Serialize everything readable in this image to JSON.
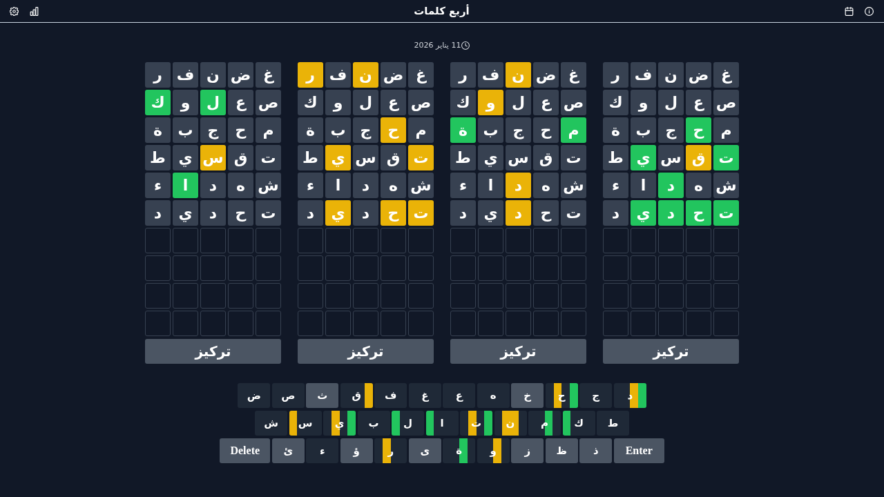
{
  "header": {
    "title": "أربع كلمات",
    "date": "11 يناير 2026"
  },
  "boards": [
    {
      "rows": [
        {
          "tiles": [
            {
              "letter": "غ",
              "kind": "absent"
            },
            {
              "letter": "ض",
              "kind": "absent"
            },
            {
              "letter": "ن",
              "kind": "absent"
            },
            {
              "letter": "ف",
              "kind": "absent"
            },
            {
              "letter": "ر",
              "kind": "absent"
            }
          ]
        },
        {
          "tiles": [
            {
              "letter": "ص",
              "kind": "absent"
            },
            {
              "letter": "ع",
              "kind": "absent"
            },
            {
              "letter": "ل",
              "kind": "absent"
            },
            {
              "letter": "و",
              "kind": "absent"
            },
            {
              "letter": "ك",
              "kind": "absent"
            }
          ]
        },
        {
          "tiles": [
            {
              "letter": "م",
              "kind": "absent"
            },
            {
              "letter": "ح",
              "kind": "correct"
            },
            {
              "letter": "ج",
              "kind": "absent"
            },
            {
              "letter": "ب",
              "kind": "absent"
            },
            {
              "letter": "ة",
              "kind": "absent"
            }
          ]
        },
        {
          "tiles": [
            {
              "letter": "ت",
              "kind": "correct"
            },
            {
              "letter": "ق",
              "kind": "present"
            },
            {
              "letter": "س",
              "kind": "absent"
            },
            {
              "letter": "ي",
              "kind": "correct"
            },
            {
              "letter": "ط",
              "kind": "absent"
            }
          ]
        },
        {
          "tiles": [
            {
              "letter": "ش",
              "kind": "absent"
            },
            {
              "letter": "ه",
              "kind": "absent"
            },
            {
              "letter": "د",
              "kind": "correct"
            },
            {
              "letter": "ا",
              "kind": "absent"
            },
            {
              "letter": "ء",
              "kind": "absent"
            }
          ]
        },
        {
          "tiles": [
            {
              "letter": "ت",
              "kind": "correct"
            },
            {
              "letter": "ح",
              "kind": "correct"
            },
            {
              "letter": "د",
              "kind": "correct"
            },
            {
              "letter": "ي",
              "kind": "correct"
            },
            {
              "letter": "د",
              "kind": "absent"
            }
          ]
        },
        {
          "tiles": [
            {
              "kind": "empty"
            },
            {
              "kind": "empty"
            },
            {
              "kind": "empty"
            },
            {
              "kind": "empty"
            },
            {
              "kind": "empty"
            }
          ]
        },
        {
          "tiles": [
            {
              "kind": "empty"
            },
            {
              "kind": "empty"
            },
            {
              "kind": "empty"
            },
            {
              "kind": "empty"
            },
            {
              "kind": "empty"
            }
          ]
        },
        {
          "tiles": [
            {
              "kind": "empty"
            },
            {
              "kind": "empty"
            },
            {
              "kind": "empty"
            },
            {
              "kind": "empty"
            },
            {
              "kind": "empty"
            }
          ]
        },
        {
          "tiles": [
            {
              "kind": "empty"
            },
            {
              "kind": "empty"
            },
            {
              "kind": "empty"
            },
            {
              "kind": "empty"
            },
            {
              "kind": "empty"
            }
          ]
        }
      ],
      "focus_label": "تركيز"
    },
    {
      "rows": [
        {
          "tiles": [
            {
              "letter": "غ",
              "kind": "absent"
            },
            {
              "letter": "ض",
              "kind": "absent"
            },
            {
              "letter": "ن",
              "kind": "present"
            },
            {
              "letter": "ف",
              "kind": "absent"
            },
            {
              "letter": "ر",
              "kind": "absent"
            }
          ]
        },
        {
          "tiles": [
            {
              "letter": "ص",
              "kind": "absent"
            },
            {
              "letter": "ع",
              "kind": "absent"
            },
            {
              "letter": "ل",
              "kind": "absent"
            },
            {
              "letter": "و",
              "kind": "present"
            },
            {
              "letter": "ك",
              "kind": "absent"
            }
          ]
        },
        {
          "tiles": [
            {
              "letter": "م",
              "kind": "correct"
            },
            {
              "letter": "ح",
              "kind": "absent"
            },
            {
              "letter": "ج",
              "kind": "absent"
            },
            {
              "letter": "ب",
              "kind": "absent"
            },
            {
              "letter": "ة",
              "kind": "correct"
            }
          ]
        },
        {
          "tiles": [
            {
              "letter": "ت",
              "kind": "absent"
            },
            {
              "letter": "ق",
              "kind": "absent"
            },
            {
              "letter": "س",
              "kind": "absent"
            },
            {
              "letter": "ي",
              "kind": "absent"
            },
            {
              "letter": "ط",
              "kind": "absent"
            }
          ]
        },
        {
          "tiles": [
            {
              "letter": "ش",
              "kind": "absent"
            },
            {
              "letter": "ه",
              "kind": "absent"
            },
            {
              "letter": "د",
              "kind": "present"
            },
            {
              "letter": "ا",
              "kind": "absent"
            },
            {
              "letter": "ء",
              "kind": "absent"
            }
          ]
        },
        {
          "tiles": [
            {
              "letter": "ت",
              "kind": "absent"
            },
            {
              "letter": "ح",
              "kind": "absent"
            },
            {
              "letter": "د",
              "kind": "present"
            },
            {
              "letter": "ي",
              "kind": "absent"
            },
            {
              "letter": "د",
              "kind": "absent"
            }
          ]
        },
        {
          "tiles": [
            {
              "kind": "empty"
            },
            {
              "kind": "empty"
            },
            {
              "kind": "empty"
            },
            {
              "kind": "empty"
            },
            {
              "kind": "empty"
            }
          ]
        },
        {
          "tiles": [
            {
              "kind": "empty"
            },
            {
              "kind": "empty"
            },
            {
              "kind": "empty"
            },
            {
              "kind": "empty"
            },
            {
              "kind": "empty"
            }
          ]
        },
        {
          "tiles": [
            {
              "kind": "empty"
            },
            {
              "kind": "empty"
            },
            {
              "kind": "empty"
            },
            {
              "kind": "empty"
            },
            {
              "kind": "empty"
            }
          ]
        },
        {
          "tiles": [
            {
              "kind": "empty"
            },
            {
              "kind": "empty"
            },
            {
              "kind": "empty"
            },
            {
              "kind": "empty"
            },
            {
              "kind": "empty"
            }
          ]
        }
      ],
      "focus_label": "تركيز"
    },
    {
      "rows": [
        {
          "tiles": [
            {
              "letter": "غ",
              "kind": "absent"
            },
            {
              "letter": "ض",
              "kind": "absent"
            },
            {
              "letter": "ن",
              "kind": "present"
            },
            {
              "letter": "ف",
              "kind": "absent"
            },
            {
              "letter": "ر",
              "kind": "present"
            }
          ]
        },
        {
          "tiles": [
            {
              "letter": "ص",
              "kind": "absent"
            },
            {
              "letter": "ع",
              "kind": "absent"
            },
            {
              "letter": "ل",
              "kind": "absent"
            },
            {
              "letter": "و",
              "kind": "absent"
            },
            {
              "letter": "ك",
              "kind": "absent"
            }
          ]
        },
        {
          "tiles": [
            {
              "letter": "م",
              "kind": "absent"
            },
            {
              "letter": "ح",
              "kind": "present"
            },
            {
              "letter": "ج",
              "kind": "absent"
            },
            {
              "letter": "ب",
              "kind": "absent"
            },
            {
              "letter": "ة",
              "kind": "absent"
            }
          ]
        },
        {
          "tiles": [
            {
              "letter": "ت",
              "kind": "present"
            },
            {
              "letter": "ق",
              "kind": "absent"
            },
            {
              "letter": "س",
              "kind": "absent"
            },
            {
              "letter": "ي",
              "kind": "present"
            },
            {
              "letter": "ط",
              "kind": "absent"
            }
          ]
        },
        {
          "tiles": [
            {
              "letter": "ش",
              "kind": "absent"
            },
            {
              "letter": "ه",
              "kind": "absent"
            },
            {
              "letter": "د",
              "kind": "absent"
            },
            {
              "letter": "ا",
              "kind": "absent"
            },
            {
              "letter": "ء",
              "kind": "absent"
            }
          ]
        },
        {
          "tiles": [
            {
              "letter": "ت",
              "kind": "present"
            },
            {
              "letter": "ح",
              "kind": "present"
            },
            {
              "letter": "د",
              "kind": "absent"
            },
            {
              "letter": "ي",
              "kind": "present"
            },
            {
              "letter": "د",
              "kind": "absent"
            }
          ]
        },
        {
          "tiles": [
            {
              "kind": "empty"
            },
            {
              "kind": "empty"
            },
            {
              "kind": "empty"
            },
            {
              "kind": "empty"
            },
            {
              "kind": "empty"
            }
          ]
        },
        {
          "tiles": [
            {
              "kind": "empty"
            },
            {
              "kind": "empty"
            },
            {
              "kind": "empty"
            },
            {
              "kind": "empty"
            },
            {
              "kind": "empty"
            }
          ]
        },
        {
          "tiles": [
            {
              "kind": "empty"
            },
            {
              "kind": "empty"
            },
            {
              "kind": "empty"
            },
            {
              "kind": "empty"
            },
            {
              "kind": "empty"
            }
          ]
        },
        {
          "tiles": [
            {
              "kind": "empty"
            },
            {
              "kind": "empty"
            },
            {
              "kind": "empty"
            },
            {
              "kind": "empty"
            },
            {
              "kind": "empty"
            }
          ]
        }
      ],
      "focus_label": "تركيز"
    },
    {
      "rows": [
        {
          "tiles": [
            {
              "letter": "غ",
              "kind": "absent"
            },
            {
              "letter": "ض",
              "kind": "absent"
            },
            {
              "letter": "ن",
              "kind": "absent"
            },
            {
              "letter": "ف",
              "kind": "absent"
            },
            {
              "letter": "ر",
              "kind": "absent"
            }
          ]
        },
        {
          "tiles": [
            {
              "letter": "ص",
              "kind": "absent"
            },
            {
              "letter": "ع",
              "kind": "absent"
            },
            {
              "letter": "ل",
              "kind": "correct"
            },
            {
              "letter": "و",
              "kind": "absent"
            },
            {
              "letter": "ك",
              "kind": "correct"
            }
          ]
        },
        {
          "tiles": [
            {
              "letter": "م",
              "kind": "absent"
            },
            {
              "letter": "ح",
              "kind": "absent"
            },
            {
              "letter": "ج",
              "kind": "absent"
            },
            {
              "letter": "ب",
              "kind": "absent"
            },
            {
              "letter": "ة",
              "kind": "absent"
            }
          ]
        },
        {
          "tiles": [
            {
              "letter": "ت",
              "kind": "absent"
            },
            {
              "letter": "ق",
              "kind": "absent"
            },
            {
              "letter": "س",
              "kind": "present"
            },
            {
              "letter": "ي",
              "kind": "absent"
            },
            {
              "letter": "ط",
              "kind": "absent"
            }
          ]
        },
        {
          "tiles": [
            {
              "letter": "ش",
              "kind": "absent"
            },
            {
              "letter": "ه",
              "kind": "absent"
            },
            {
              "letter": "د",
              "kind": "absent"
            },
            {
              "letter": "ا",
              "kind": "correct"
            },
            {
              "letter": "ء",
              "kind": "absent"
            }
          ]
        },
        {
          "tiles": [
            {
              "letter": "ت",
              "kind": "absent"
            },
            {
              "letter": "ح",
              "kind": "absent"
            },
            {
              "letter": "د",
              "kind": "absent"
            },
            {
              "letter": "ي",
              "kind": "absent"
            },
            {
              "letter": "د",
              "kind": "absent"
            }
          ]
        },
        {
          "tiles": [
            {
              "kind": "empty"
            },
            {
              "kind": "empty"
            },
            {
              "kind": "empty"
            },
            {
              "kind": "empty"
            },
            {
              "kind": "empty"
            }
          ]
        },
        {
          "tiles": [
            {
              "kind": "empty"
            },
            {
              "kind": "empty"
            },
            {
              "kind": "empty"
            },
            {
              "kind": "empty"
            },
            {
              "kind": "empty"
            }
          ]
        },
        {
          "tiles": [
            {
              "kind": "empty"
            },
            {
              "kind": "empty"
            },
            {
              "kind": "empty"
            },
            {
              "kind": "empty"
            },
            {
              "kind": "empty"
            }
          ]
        },
        {
          "tiles": [
            {
              "kind": "empty"
            },
            {
              "kind": "empty"
            },
            {
              "kind": "empty"
            },
            {
              "kind": "empty"
            },
            {
              "kind": "empty"
            }
          ]
        }
      ],
      "focus_label": "تركيز"
    }
  ],
  "keyboard": {
    "rows": [
      {
        "keys": [
          {
            "kind": "letter",
            "label": "د",
            "used": true,
            "strips": [
              {
                "kind": "correct"
              },
              {
                "kind": "present"
              },
              {
                "kind": "none"
              },
              {
                "kind": "none"
              }
            ]
          },
          {
            "kind": "letter",
            "label": "ج",
            "used": true
          },
          {
            "kind": "letter",
            "label": "ح",
            "used": true,
            "strips": [
              {
                "kind": "correct"
              },
              {
                "kind": "none"
              },
              {
                "kind": "present"
              },
              {
                "kind": "none"
              }
            ]
          },
          {
            "kind": "letter",
            "label": "خ",
            "used": false
          },
          {
            "kind": "letter",
            "label": "ه",
            "used": true
          },
          {
            "kind": "letter",
            "label": "ع",
            "used": true
          },
          {
            "kind": "letter",
            "label": "غ",
            "used": true
          },
          {
            "kind": "letter",
            "label": "ف",
            "used": true
          },
          {
            "kind": "letter",
            "label": "ق",
            "used": true,
            "strips": [
              {
                "kind": "present"
              },
              {
                "kind": "none"
              },
              {
                "kind": "none"
              },
              {
                "kind": "none"
              }
            ]
          },
          {
            "kind": "letter",
            "label": "ث",
            "used": false
          },
          {
            "kind": "letter",
            "label": "ص",
            "used": true
          },
          {
            "kind": "letter",
            "label": "ض",
            "used": true
          }
        ]
      },
      {
        "keys": [
          {
            "kind": "letter",
            "label": "ط",
            "used": true
          },
          {
            "kind": "letter",
            "label": "ك",
            "used": true,
            "strips": [
              {
                "kind": "none"
              },
              {
                "kind": "none"
              },
              {
                "kind": "none"
              },
              {
                "kind": "correct"
              }
            ]
          },
          {
            "kind": "letter",
            "label": "م",
            "used": true,
            "strips": [
              {
                "kind": "none"
              },
              {
                "kind": "correct"
              },
              {
                "kind": "none"
              },
              {
                "kind": "none"
              }
            ]
          },
          {
            "kind": "letter",
            "label": "ن",
            "used": true,
            "strips": [
              {
                "kind": "none"
              },
              {
                "kind": "present"
              },
              {
                "kind": "present"
              },
              {
                "kind": "none"
              }
            ]
          },
          {
            "kind": "letter",
            "label": "ت",
            "used": true,
            "strips": [
              {
                "kind": "correct"
              },
              {
                "kind": "none"
              },
              {
                "kind": "present"
              },
              {
                "kind": "none"
              }
            ]
          },
          {
            "kind": "letter",
            "label": "ا",
            "used": true,
            "strips": [
              {
                "kind": "none"
              },
              {
                "kind": "none"
              },
              {
                "kind": "none"
              },
              {
                "kind": "correct"
              }
            ]
          },
          {
            "kind": "letter",
            "label": "ل",
            "used": true,
            "strips": [
              {
                "kind": "none"
              },
              {
                "kind": "none"
              },
              {
                "kind": "none"
              },
              {
                "kind": "correct"
              }
            ]
          },
          {
            "kind": "letter",
            "label": "ب",
            "used": true
          },
          {
            "kind": "letter",
            "label": "ي",
            "used": true,
            "strips": [
              {
                "kind": "correct"
              },
              {
                "kind": "none"
              },
              {
                "kind": "present"
              },
              {
                "kind": "none"
              }
            ]
          },
          {
            "kind": "letter",
            "label": "س",
            "used": true,
            "strips": [
              {
                "kind": "none"
              },
              {
                "kind": "none"
              },
              {
                "kind": "none"
              },
              {
                "kind": "present"
              }
            ]
          },
          {
            "kind": "letter",
            "label": "ش",
            "used": true
          }
        ]
      },
      {
        "keys": [
          {
            "kind": "enter",
            "label": "Enter"
          },
          {
            "kind": "letter",
            "label": "ذ",
            "used": false
          },
          {
            "kind": "letter",
            "label": "ظ",
            "used": false
          },
          {
            "kind": "letter",
            "label": "ز",
            "used": false
          },
          {
            "kind": "letter",
            "label": "و",
            "used": true,
            "strips": [
              {
                "kind": "none"
              },
              {
                "kind": "present"
              },
              {
                "kind": "none"
              },
              {
                "kind": "none"
              }
            ]
          },
          {
            "kind": "letter",
            "label": "ة",
            "used": true,
            "strips": [
              {
                "kind": "none"
              },
              {
                "kind": "correct"
              },
              {
                "kind": "none"
              },
              {
                "kind": "none"
              }
            ]
          },
          {
            "kind": "letter",
            "label": "ى",
            "used": false
          },
          {
            "kind": "letter",
            "label": "ر",
            "used": true,
            "strips": [
              {
                "kind": "none"
              },
              {
                "kind": "none"
              },
              {
                "kind": "present"
              },
              {
                "kind": "none"
              }
            ]
          },
          {
            "kind": "letter",
            "label": "ؤ",
            "used": false
          },
          {
            "kind": "letter",
            "label": "ء",
            "used": true
          },
          {
            "kind": "letter",
            "label": "ئ",
            "used": false
          },
          {
            "kind": "delete",
            "label": "Delete"
          }
        ]
      }
    ]
  }
}
